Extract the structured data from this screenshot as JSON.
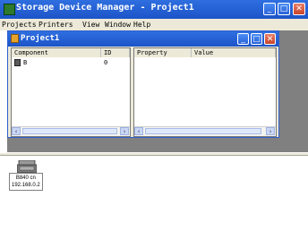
{
  "app": {
    "title": "Storage Device Manager - Project1"
  },
  "menu": [
    "Projects",
    "Printers",
    "View",
    "Window",
    "Help"
  ],
  "child": {
    "title": "Project1",
    "left_headers": [
      "Component",
      "ID"
    ],
    "rows": [
      {
        "component": "B",
        "id": "0"
      }
    ],
    "right_headers": [
      "Property",
      "Value"
    ]
  },
  "device": {
    "name": "B840 cn",
    "ip": "192.168.0.2"
  },
  "icons": [
    "app-icon",
    "minimize-icon",
    "maximize-icon",
    "close-icon",
    "folder-icon",
    "printer-icon",
    "scroll-left-icon",
    "scroll-right-icon"
  ],
  "colors": {
    "titlebar": "#1c54c8",
    "workspace": "#808080",
    "close": "#c8442a",
    "chrome": "#ece9d8"
  }
}
